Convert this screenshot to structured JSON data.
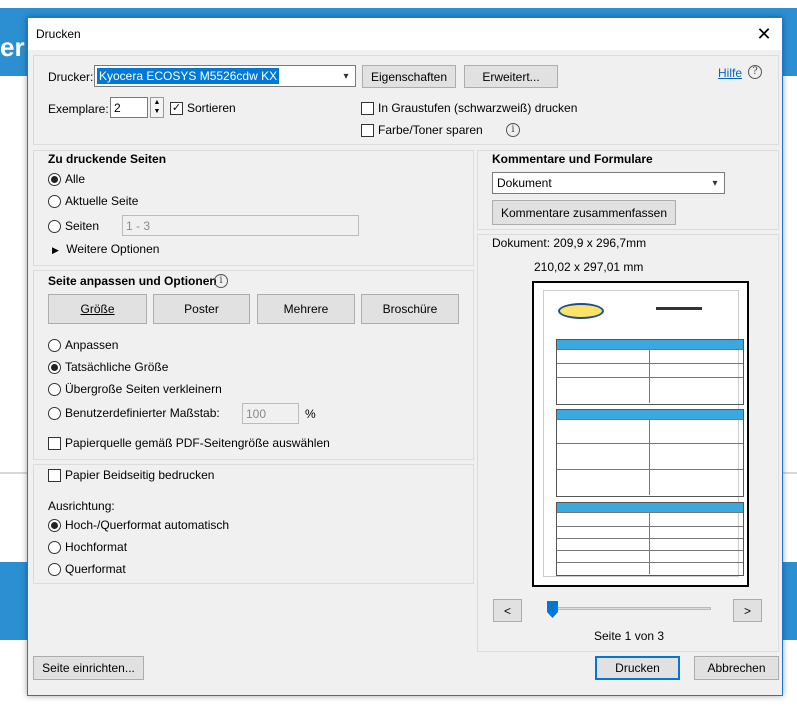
{
  "background": {
    "partial_title": "er"
  },
  "dialog": {
    "title": "Drucken",
    "close_glyph": "✕"
  },
  "top": {
    "printer_label": "Drucker:",
    "printer_value": "Kyocera ECOSYS M5526cdw KX",
    "properties_button": "Eigenschaften",
    "advanced_button": "Erweitert...",
    "help_link": "Hilfe",
    "copies_label": "Exemplare:",
    "copies_value": "2",
    "collate_label": "Sortieren",
    "collate_checked": true,
    "grayscale_label": "In Graustufen (schwarzweiß) drucken",
    "save_toner_label": "Farbe/Toner sparen"
  },
  "pages": {
    "heading": "Zu druckende Seiten",
    "all_label": "Alle",
    "current_label": "Aktuelle Seite",
    "pages_label": "Seiten",
    "pages_value": "1 - 3",
    "more_options_label": "Weitere Optionen"
  },
  "sizing": {
    "heading": "Seite anpassen und Optionen",
    "size_button": "Größe",
    "poster_button": "Poster",
    "multiple_button": "Mehrere",
    "booklet_button": "Broschüre",
    "fit_label": "Anpassen",
    "actual_label": "Tatsächliche Größe",
    "shrink_label": "Übergroße Seiten verkleinern",
    "custom_label": "Benutzerdefinierter Maßstab:",
    "custom_value": "100",
    "custom_unit": "%",
    "paper_source_label": "Papierquelle gemäß PDF-Seitengröße auswählen"
  },
  "duplex": {
    "duplex_label": "Papier Beidseitig bedrucken",
    "orientation_label": "Ausrichtung:",
    "auto_label": "Hoch-/Querformat automatisch",
    "portrait_label": "Hochformat",
    "landscape_label": "Querformat"
  },
  "comments": {
    "heading": "Kommentare und Formulare",
    "select_value": "Dokument",
    "summarize_button": "Kommentare zusammenfassen"
  },
  "preview": {
    "document_size": "Dokument: 209,9 x 296,7mm",
    "paper_size": "210,02 x 297,01 mm",
    "prev_glyph": "<",
    "next_glyph": ">",
    "page_indicator": "Seite 1 von 3",
    "current_page": 1,
    "total_pages": 3
  },
  "footer": {
    "page_setup_button": "Seite einrichten...",
    "print_button": "Drucken",
    "cancel_button": "Abbrechen"
  },
  "colors": {
    "accent": "#0078d7",
    "background_band": "#2b8fd2",
    "preview_header": "#3ba9e0"
  }
}
